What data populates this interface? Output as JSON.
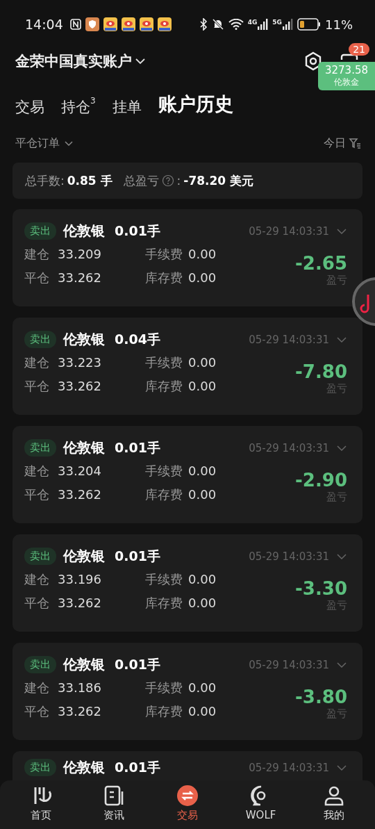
{
  "status_bar": {
    "time": "14:04",
    "network_1": "4G",
    "network_2": "5G",
    "battery": "11%"
  },
  "header": {
    "account": "金荣中国真实账户",
    "badge": "21",
    "quote": {
      "value": "3273.58",
      "name": "伦敦金"
    }
  },
  "tabs": [
    {
      "label": "交易",
      "selected": false
    },
    {
      "label": "持仓",
      "count": "3",
      "selected": false
    },
    {
      "label": "挂单",
      "selected": false
    },
    {
      "label": "账户历史",
      "selected": true
    }
  ],
  "filter": {
    "type": "平仓订单",
    "range": "今日"
  },
  "summary": {
    "lots_label": "总手数:",
    "lots": "0.85 手",
    "pnl_label": "总盈亏",
    "pnl_colon": ":",
    "pnl": "-78.20 美元"
  },
  "orders": [
    {
      "side": "卖出",
      "symbol": "伦敦银",
      "lots": "0.01手",
      "time": "05-29 14:03:31",
      "open_label": "建仓",
      "open": "33.209",
      "close_label": "平仓",
      "close": "33.262",
      "fee_label": "手续费",
      "fee": "0.00",
      "swap_label": "库存费",
      "swap": "0.00",
      "pnl": "-2.65",
      "pnl_label": "盈亏"
    },
    {
      "side": "卖出",
      "symbol": "伦敦银",
      "lots": "0.04手",
      "time": "05-29 14:03:31",
      "open_label": "建仓",
      "open": "33.223",
      "close_label": "平仓",
      "close": "33.262",
      "fee_label": "手续费",
      "fee": "0.00",
      "swap_label": "库存费",
      "swap": "0.00",
      "pnl": "-7.80",
      "pnl_label": "盈亏"
    },
    {
      "side": "卖出",
      "symbol": "伦敦银",
      "lots": "0.01手",
      "time": "05-29 14:03:31",
      "open_label": "建仓",
      "open": "33.204",
      "close_label": "平仓",
      "close": "33.262",
      "fee_label": "手续费",
      "fee": "0.00",
      "swap_label": "库存费",
      "swap": "0.00",
      "pnl": "-2.90",
      "pnl_label": "盈亏"
    },
    {
      "side": "卖出",
      "symbol": "伦敦银",
      "lots": "0.01手",
      "time": "05-29 14:03:31",
      "open_label": "建仓",
      "open": "33.196",
      "close_label": "平仓",
      "close": "33.262",
      "fee_label": "手续费",
      "fee": "0.00",
      "swap_label": "库存费",
      "swap": "0.00",
      "pnl": "-3.30",
      "pnl_label": "盈亏"
    },
    {
      "side": "卖出",
      "symbol": "伦敦银",
      "lots": "0.01手",
      "time": "05-29 14:03:31",
      "open_label": "建仓",
      "open": "33.186",
      "close_label": "平仓",
      "close": "33.262",
      "fee_label": "手续费",
      "fee": "0.00",
      "swap_label": "库存费",
      "swap": "0.00",
      "pnl": "-3.80",
      "pnl_label": "盈亏"
    },
    {
      "side": "卖出",
      "symbol": "伦敦银",
      "lots": "0.01手",
      "time": "05-29 14:03:31"
    }
  ],
  "nav": [
    {
      "kind": "home",
      "label": "首页",
      "selected": false
    },
    {
      "kind": "news",
      "label": "资讯",
      "selected": false
    },
    {
      "kind": "trade",
      "label": "交易",
      "selected": true
    },
    {
      "kind": "wolf",
      "label": "WOLF",
      "selected": false
    },
    {
      "kind": "me",
      "label": "我的",
      "selected": false
    }
  ]
}
